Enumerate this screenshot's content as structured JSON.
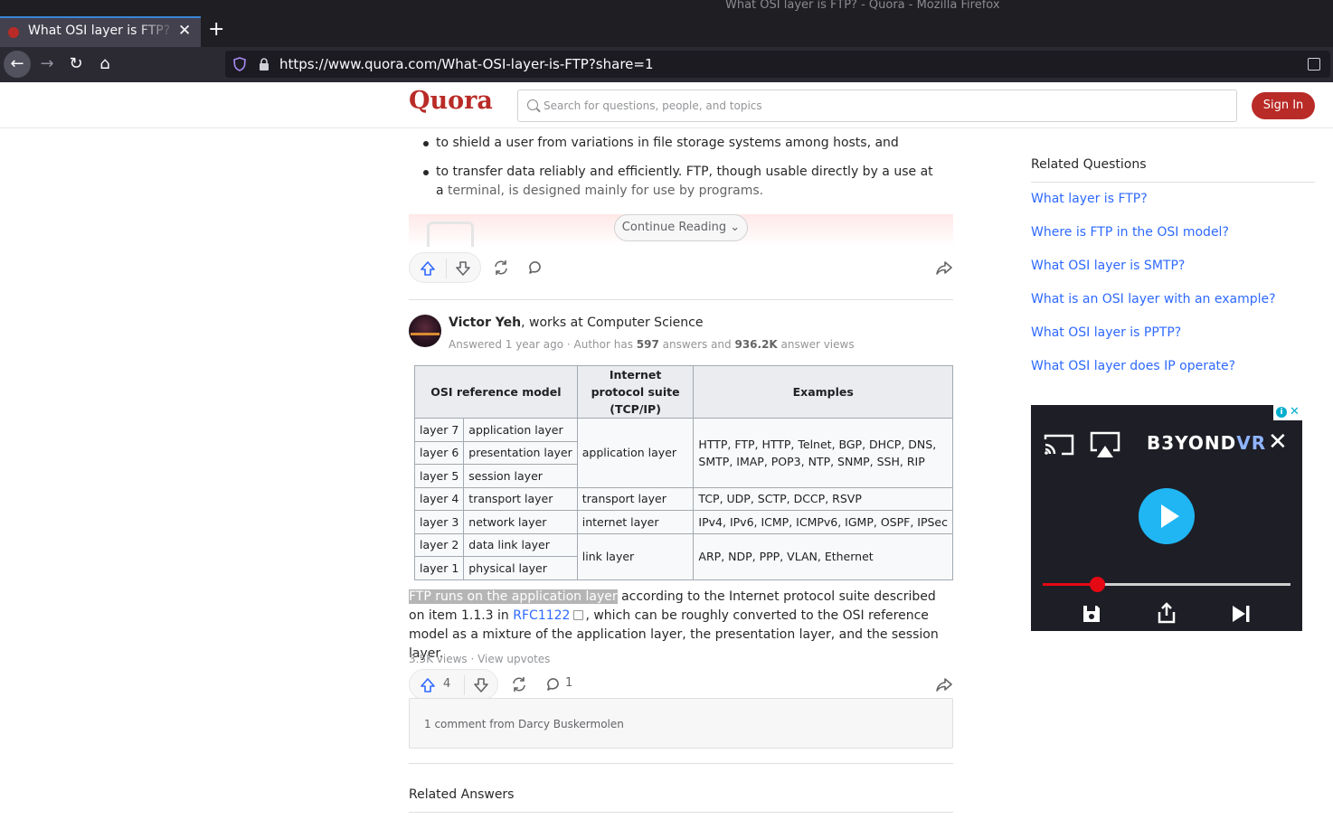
{
  "window": {
    "title": "What OSI layer is FTP? - Quora - Mozilla Firefox"
  },
  "tab": {
    "label": "What OSI layer is FTP? - Quora"
  },
  "browser": {
    "url": "https://www.quora.com/What-OSI-layer-is-FTP?share=1"
  },
  "header": {
    "logo": "Quora",
    "search_placeholder": "Search for questions, people, and topics",
    "signin_label": "Sign In"
  },
  "prev_answer": {
    "bullets": [
      {
        "text": "to shield a user from variations in file storage systems among hosts, and",
        "soft": ""
      },
      {
        "text": "to transfer data reliably and efficiently. FTP, though usable directly by a use at a ",
        "soft": "terminal, is designed mainly for use by programs."
      }
    ],
    "continue_label": "Continue Reading"
  },
  "answer": {
    "author_name": "Victor Yeh",
    "author_cred": ", works at Computer Science",
    "meta_prefix": "Answered 1 year ago · Author has ",
    "answers_count": "597",
    "meta_mid": " answers and ",
    "views_count": "936.2K",
    "meta_suffix": " answer views",
    "table": {
      "headers": [
        "OSI reference model",
        "Internet protocol suite (TCP/IP)",
        "Examples"
      ],
      "layers": [
        {
          "num": "layer 7",
          "name": "application layer"
        },
        {
          "num": "layer 6",
          "name": "presentation layer"
        },
        {
          "num": "layer 5",
          "name": "session layer"
        },
        {
          "num": "layer 4",
          "name": "transport layer"
        },
        {
          "num": "layer 3",
          "name": "network layer"
        },
        {
          "num": "layer 2",
          "name": "data link layer"
        },
        {
          "num": "layer 1",
          "name": "physical layer"
        }
      ],
      "tcpip": [
        "application layer",
        "transport layer",
        "internet layer",
        "link layer"
      ],
      "examples": [
        "HTTP, FTP, HTTP, Telnet, BGP, DHCP, DNS, SMTP, IMAP, POP3, NTP, SNMP, SSH, RIP",
        "TCP, UDP, SCTP, DCCP, RSVP",
        "IPv4, IPv6, ICMP, ICMPv6, IGMP, OSPF, IPSec",
        "ARP, NDP, PPP, VLAN, Ethernet"
      ]
    },
    "text_highlight": "FTP runs on the application layer",
    "text_1": " according to the Internet protocol suite described on item 1.1.3 in ",
    "link": "RFC1122",
    "text_2": ", which can be roughly converted to the OSI reference model as a mixture of the application layer, the presentation layer, and the session layer.",
    "views": "3.5K views",
    "view_upvotes": "View upvotes",
    "upvotes": "4",
    "comments": "1",
    "comment_box": "1 comment from Darcy Buskermolen"
  },
  "related_answers_title": "Related Answers",
  "sidebar": {
    "title": "Related Questions",
    "questions": [
      "What layer is FTP?",
      "Where is FTP in the OSI model?",
      "What OSI layer is SMTP?",
      "What is an OSI layer with an example?",
      "What OSI layer is PPTP?",
      "What OSI layer does IP operate?"
    ]
  },
  "ad": {
    "brand_a": "B3YOND",
    "brand_b": "VR",
    "progress": 0.22
  },
  "colors": {
    "quora_red": "#b92b27",
    "link_blue": "#2e69ff",
    "firefox_dark": "#1f1f23"
  }
}
